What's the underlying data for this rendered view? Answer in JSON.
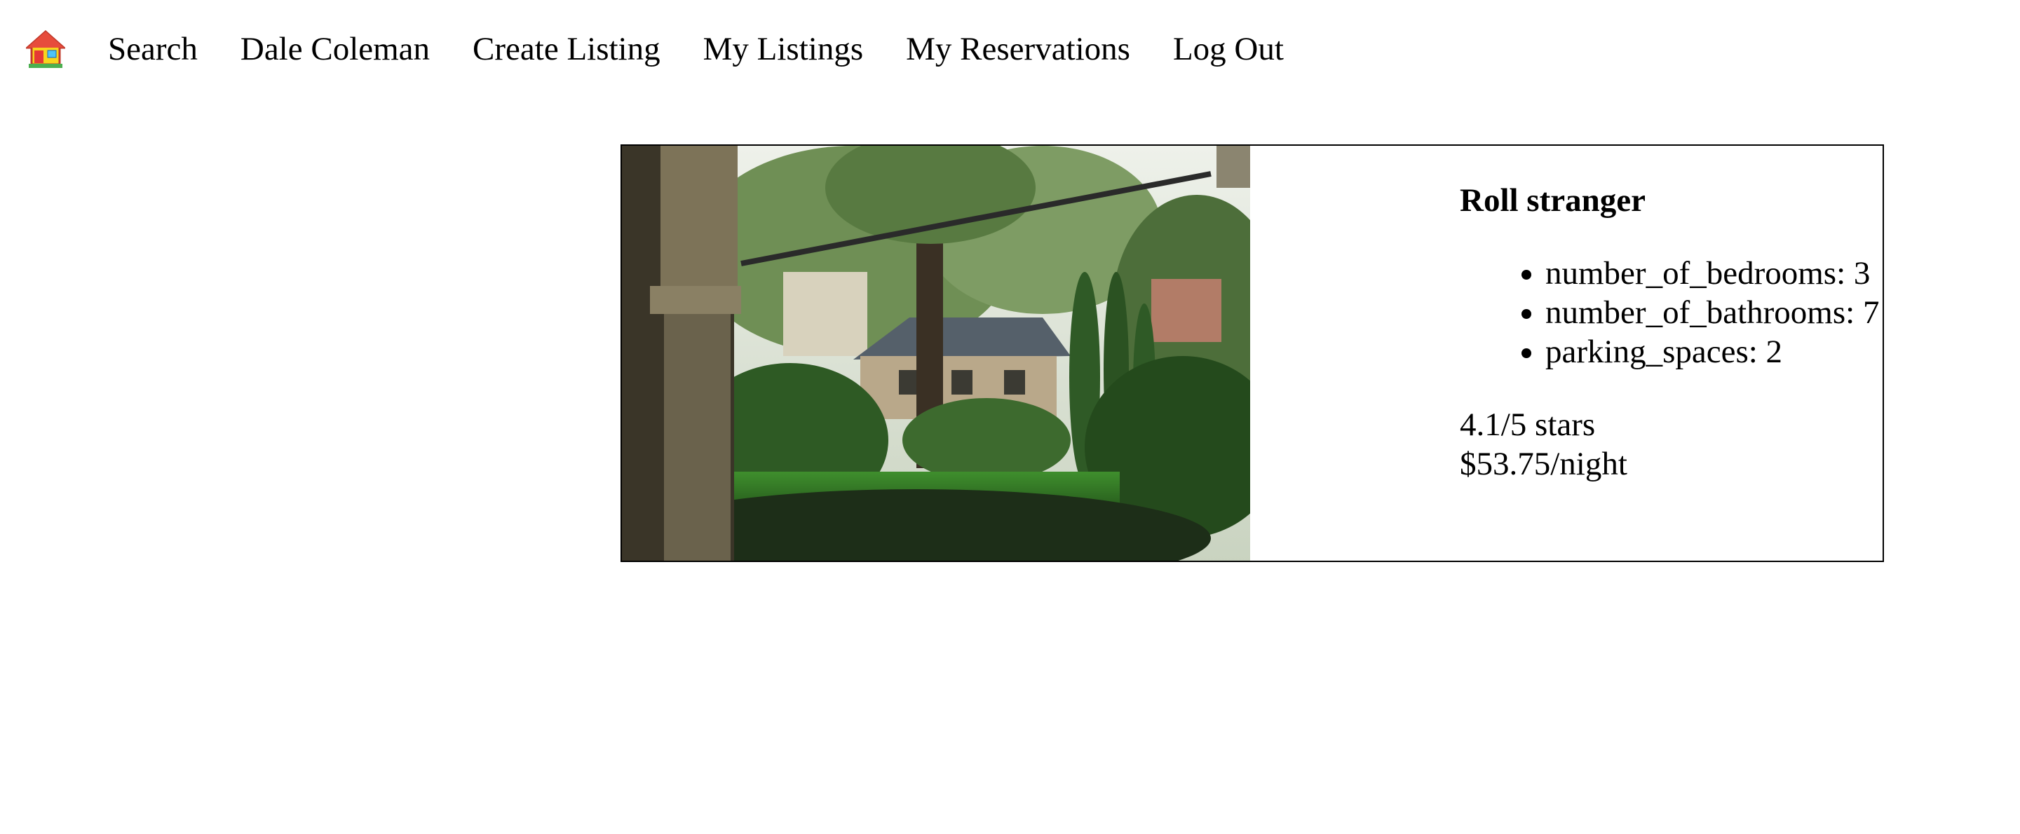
{
  "nav": {
    "home_icon": "house-icon",
    "links": [
      "Search",
      "Dale Coleman",
      "Create Listing",
      "My Listings",
      "My Reservations",
      "Log Out"
    ]
  },
  "listing": {
    "title": "Roll stranger",
    "features": [
      "number_of_bedrooms: 3",
      "number_of_bathrooms: 7",
      "parking_spaces: 2"
    ],
    "rating": "4.1/5 stars",
    "price": "$53.75/night"
  }
}
